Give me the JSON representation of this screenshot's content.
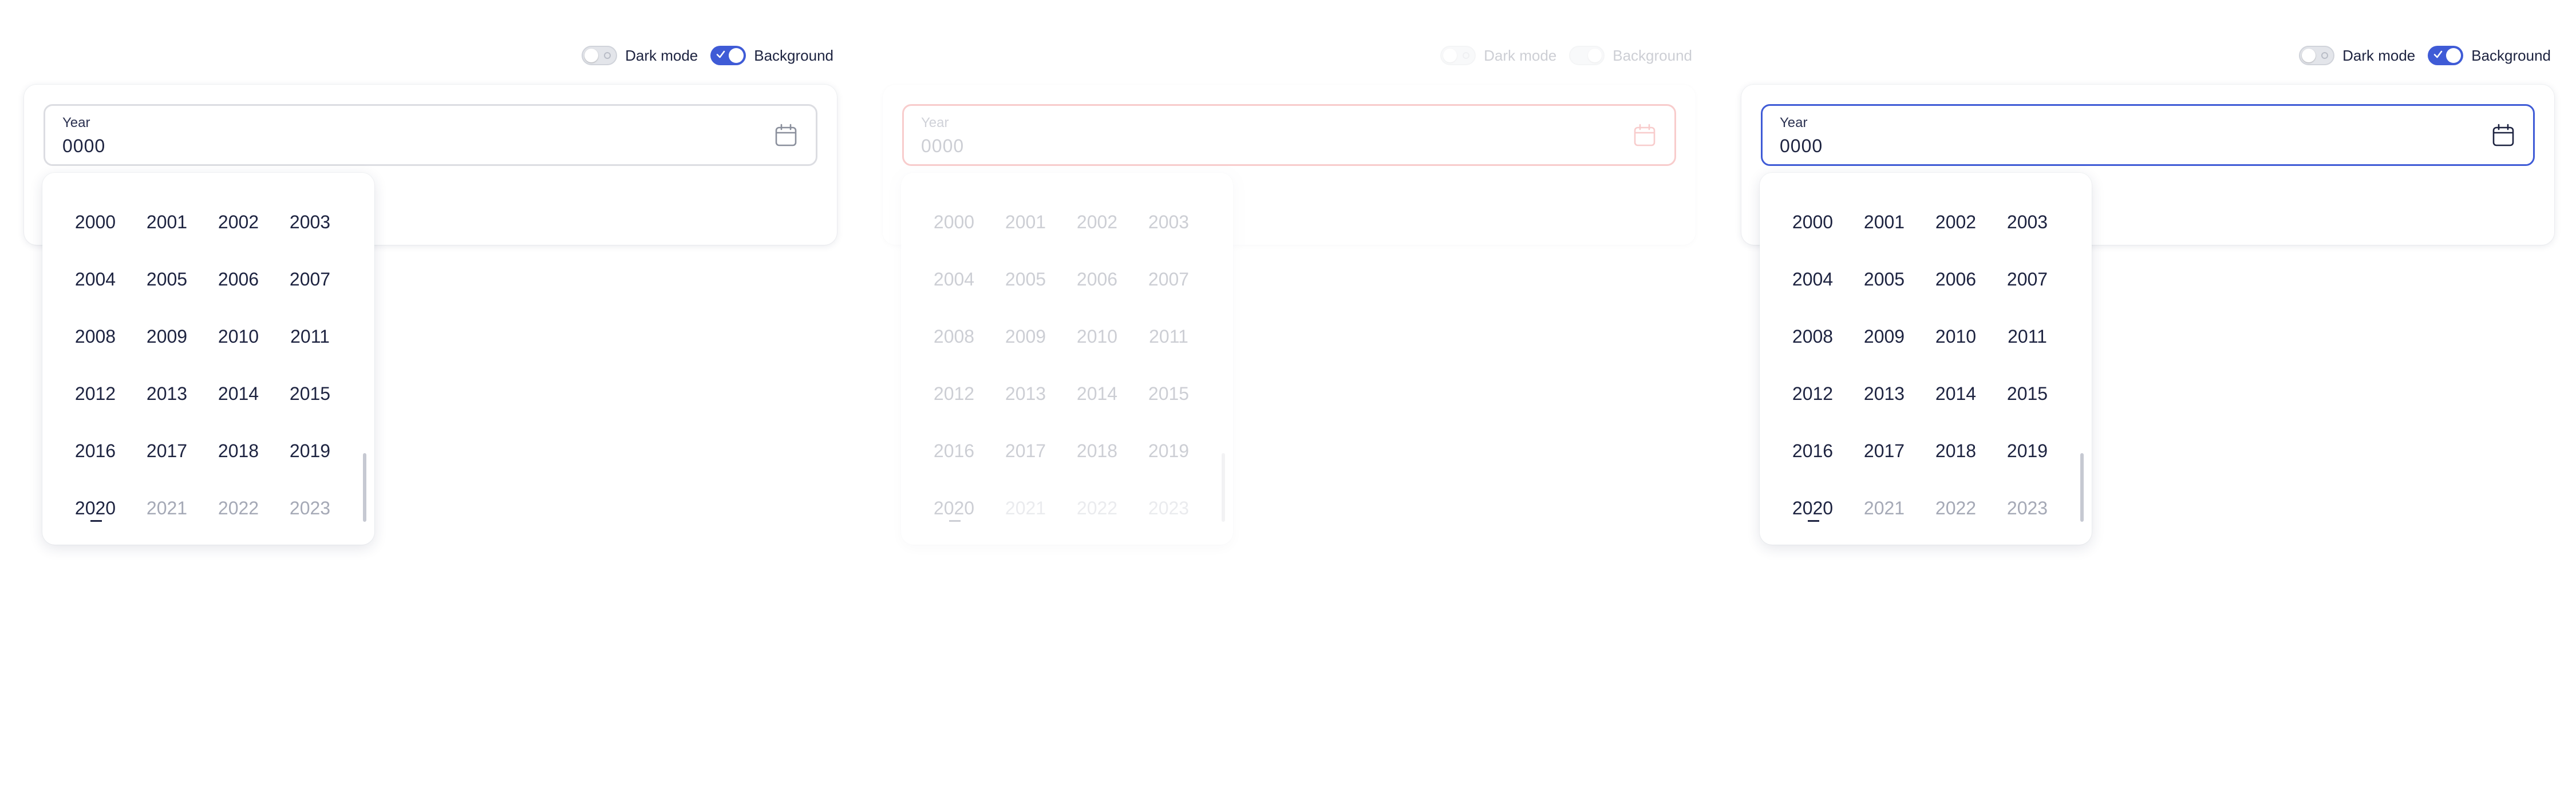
{
  "toggles": {
    "dark_mode_label": "Dark mode",
    "background_label": "Background"
  },
  "field": {
    "label": "Year",
    "value": "0000",
    "icon": "calendar-icon"
  },
  "years": [
    "2000",
    "2001",
    "2002",
    "2003",
    "2004",
    "2005",
    "2006",
    "2007",
    "2008",
    "2009",
    "2010",
    "2011",
    "2012",
    "2013",
    "2014",
    "2015",
    "2016",
    "2017",
    "2018",
    "2019",
    "2020",
    "2021",
    "2022",
    "2023"
  ],
  "colors": {
    "accent": "#3f5bd6",
    "error": "#e01b1b",
    "text": "#1d2340",
    "muted": "#a5a9b6"
  },
  "states": [
    "default",
    "error",
    "focused"
  ]
}
